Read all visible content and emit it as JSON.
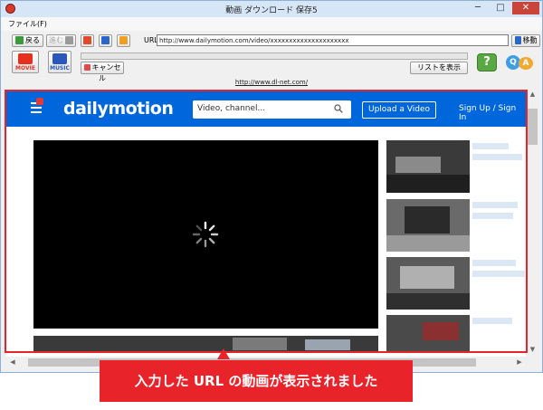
{
  "window": {
    "title": "動画 ダウンロード 保存5",
    "minimize": "─",
    "maximize": "□",
    "close": "✕"
  },
  "menu": {
    "file": "ファイル(F)"
  },
  "toolbar": {
    "back": "戻る",
    "forward": "進む",
    "url_label": "URL",
    "url_value": "http://www.dailymotion.com/video/xxxxxxxxxxxxxxxxxxxxx",
    "go": "移動",
    "movie": "MOVIE",
    "music": "MUSIC",
    "cancel": "キャンセル",
    "list": "リストを表示",
    "help": "?",
    "qa_q": "Q",
    "qa_a": "A",
    "progress": 0
  },
  "site_link": "http://www.dl-net.com/",
  "dailymotion": {
    "logo": "dailymotion",
    "search_placeholder": "Video, channel...",
    "upload": "Upload a Video",
    "signin": "Sign Up / Sign In"
  },
  "annotation": {
    "callout": "入力した URL の動画が表示されました"
  },
  "colors": {
    "accent": "#e8242a",
    "dm_blue": "#0066dc"
  }
}
